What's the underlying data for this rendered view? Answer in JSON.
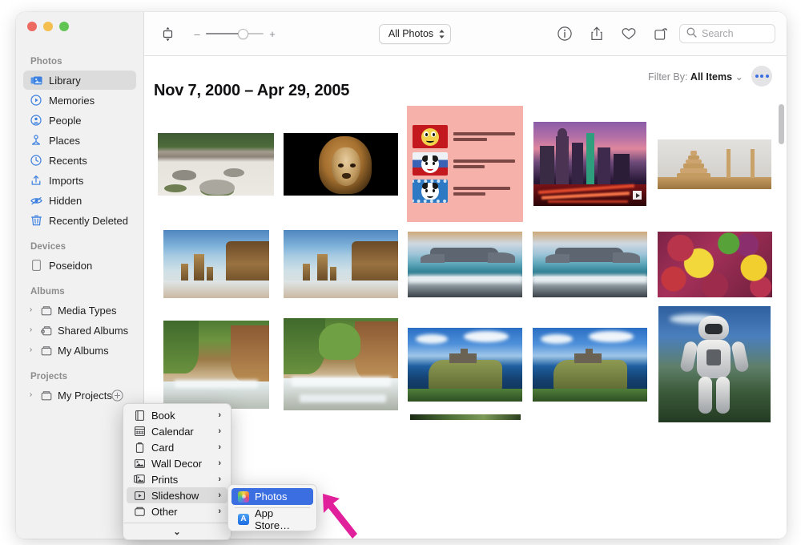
{
  "window": {
    "traffic_lights": [
      "close",
      "minimize",
      "zoom"
    ]
  },
  "toolbar": {
    "sidebar_toggle_icon": "sidebar-toggle-icon",
    "zoom_out_label": "–",
    "zoom_in_label": "+",
    "zoom_value": 62,
    "view_popup": "All Photos",
    "info_icon": "info-icon",
    "share_icon": "share-icon",
    "favorite_icon": "heart-icon",
    "rotate_icon": "rotate-icon",
    "search_placeholder": "Search",
    "search_value": ""
  },
  "sidebar": {
    "sections": [
      {
        "title": "Photos",
        "items": [
          {
            "label": "Library",
            "icon": "library-icon",
            "selected": true
          },
          {
            "label": "Memories",
            "icon": "memories-icon",
            "selected": false
          },
          {
            "label": "People",
            "icon": "people-icon",
            "selected": false
          },
          {
            "label": "Places",
            "icon": "places-icon",
            "selected": false
          },
          {
            "label": "Recents",
            "icon": "recents-icon",
            "selected": false
          },
          {
            "label": "Imports",
            "icon": "imports-icon",
            "selected": false
          },
          {
            "label": "Hidden",
            "icon": "hidden-icon",
            "selected": false
          },
          {
            "label": "Recently Deleted",
            "icon": "trash-icon",
            "selected": false
          }
        ]
      },
      {
        "title": "Devices",
        "items": [
          {
            "label": "Poseidon",
            "icon": "device-icon",
            "selected": false
          }
        ]
      },
      {
        "title": "Albums",
        "items": [
          {
            "label": "Media Types",
            "icon": "folder-icon",
            "selected": false,
            "disclosure": "›"
          },
          {
            "label": "Shared Albums",
            "icon": "shared-folder-icon",
            "selected": false,
            "disclosure": "›"
          },
          {
            "label": "My Albums",
            "icon": "folder-icon",
            "selected": false,
            "disclosure": "›"
          }
        ]
      },
      {
        "title": "Projects",
        "items": [
          {
            "label": "My Projects",
            "icon": "folder-icon",
            "selected": false,
            "disclosure": "›",
            "add_button": "add-project-button"
          }
        ]
      }
    ]
  },
  "content": {
    "date_range": "Nov 7, 2000 – Apr 29, 2005",
    "filter_label": "Filter By:",
    "filter_value": "All Items",
    "filter_chevron": "⌄",
    "more_button": "more-options-button"
  },
  "photos": {
    "rows": [
      [
        {
          "name": "zen-garden",
          "w": 145,
          "h": 78
        },
        {
          "name": "lion-on-black",
          "w": 143,
          "h": 78
        },
        {
          "name": "japanese-cat-card",
          "w": 145,
          "h": 145
        },
        {
          "name": "city-at-dusk-video",
          "w": 141,
          "h": 105,
          "badge": "video"
        },
        {
          "name": "wooden-tower-of-hanoi",
          "w": 142,
          "h": 62
        }
      ],
      [
        {
          "name": "twelve-apostles-a",
          "w": 132,
          "h": 85
        },
        {
          "name": "twelve-apostles-b",
          "w": 143,
          "h": 85
        },
        {
          "name": "table-mountain-a",
          "w": 143,
          "h": 82
        },
        {
          "name": "table-mountain-b",
          "w": 143,
          "h": 82
        },
        {
          "name": "wet-autumn-leaves",
          "w": 143,
          "h": 82
        }
      ],
      [
        {
          "name": "waterfall-canyon-a",
          "w": 132,
          "h": 110
        },
        {
          "name": "waterfall-canyon-b",
          "w": 143,
          "h": 115
        },
        {
          "name": "dunnottar-castle-a",
          "w": 143,
          "h": 92
        },
        {
          "name": "dunnottar-castle-b",
          "w": 143,
          "h": 92
        },
        {
          "name": "humanoid-robot",
          "w": 140,
          "h": 145
        }
      ]
    ],
    "japanese_card": {
      "rows": [
        {
          "thumb": "felix-red-card",
          "line1": "フィリックスガム (マルカワ)",
          "line2": "目が大きい"
        },
        {
          "thumb": "felix-blue-card",
          "line1": "エフエックスガム (マルカワ)",
          "line2": "鼻が長い"
        },
        {
          "thumb": "kuroneko-film-card",
          "line1": "のらくろガム (フジヤ)",
          "line2": "耳がとがる"
        }
      ]
    }
  },
  "context_menu": {
    "items": [
      {
        "label": "Book",
        "icon": "book-icon",
        "arrow": "›",
        "highlighted": false
      },
      {
        "label": "Calendar",
        "icon": "calendar-icon",
        "arrow": "›",
        "highlighted": false
      },
      {
        "label": "Card",
        "icon": "card-icon",
        "arrow": "›",
        "highlighted": false
      },
      {
        "label": "Wall Decor",
        "icon": "wall-decor-icon",
        "arrow": "›",
        "highlighted": false
      },
      {
        "label": "Prints",
        "icon": "prints-icon",
        "arrow": "›",
        "highlighted": false
      },
      {
        "label": "Slideshow",
        "icon": "slideshow-icon",
        "arrow": "›",
        "highlighted": true
      },
      {
        "label": "Other",
        "icon": "other-icon",
        "arrow": "›",
        "highlighted": false
      }
    ],
    "scroll_more": "⌄"
  },
  "submenu": {
    "items": [
      {
        "label": "Photos",
        "icon": "photos-app-icon",
        "selected": true
      },
      {
        "label": "App Store…",
        "icon": "app-store-icon",
        "selected": false
      }
    ]
  },
  "annotation": {
    "cursor": "magenta-arrow-pointer",
    "color": "#e0219b"
  }
}
